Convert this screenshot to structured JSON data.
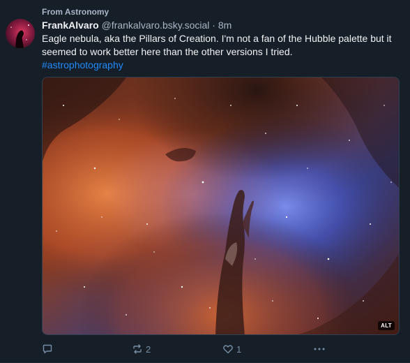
{
  "feed_context": "From Astronomy",
  "author": {
    "display_name": "FrankAlvaro",
    "handle": "@frankalvaro.bsky.social",
    "separator": "·",
    "time_ago": "8m",
    "avatar_icon": "horsehead-nebula-avatar"
  },
  "post": {
    "text": "Eagle nebula, aka the Pillars of Creation. I'm not a fan of the Hubble palette but it seemed to work better here than the other versions I tried.",
    "hashtag": "#astrophotography"
  },
  "media": {
    "alt_label": "ALT",
    "subject": "Eagle nebula astrophotograph"
  },
  "actions": {
    "reply_icon": "reply-icon",
    "repost_icon": "repost-icon",
    "repost_count": "2",
    "like_icon": "heart-icon",
    "like_count": "1",
    "more_icon": "ellipsis-icon"
  },
  "colors": {
    "background": "#161e27",
    "text_primary": "#f1f3f5",
    "text_secondary": "#a9b6c5",
    "link": "#208bfe",
    "icon": "#788ea5"
  }
}
